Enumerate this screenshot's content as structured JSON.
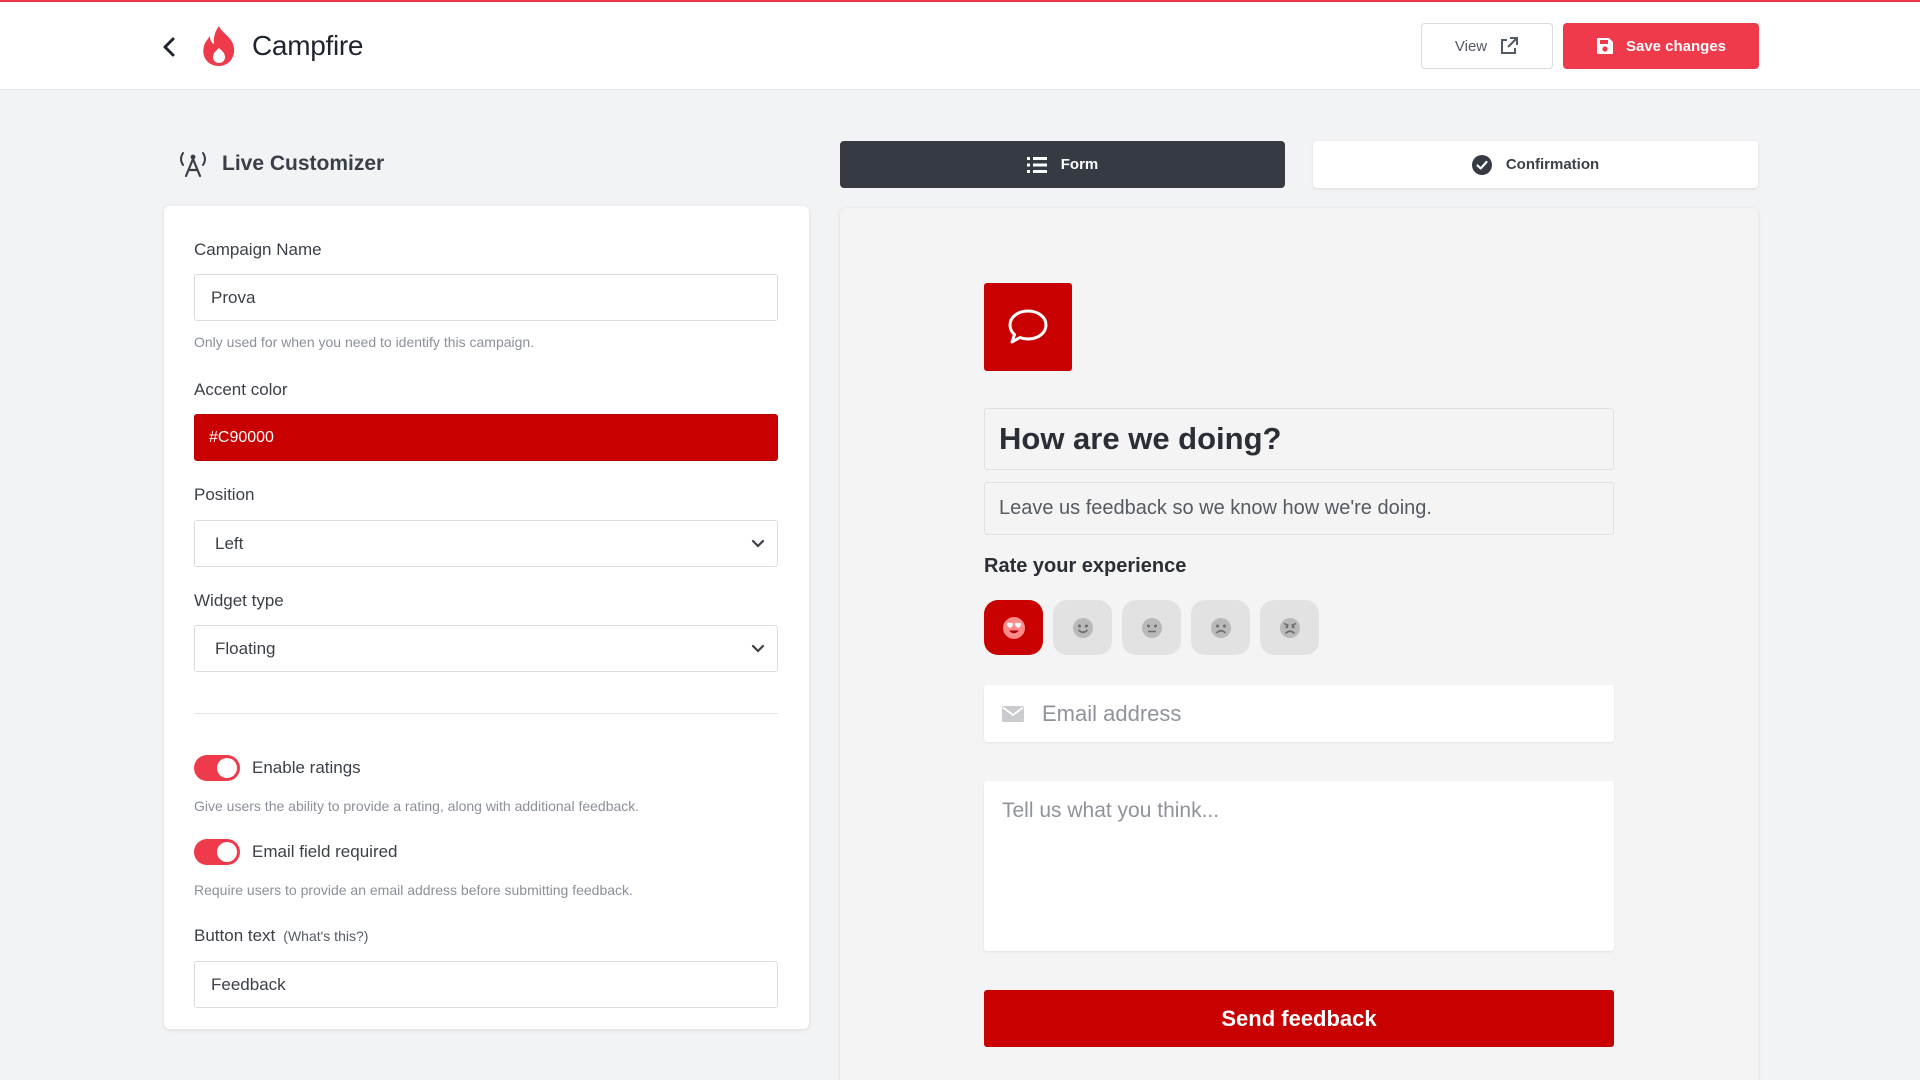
{
  "brand": {
    "name": "Campfire",
    "accent": "#ee3a4b"
  },
  "header": {
    "view_label": "View",
    "save_label": "Save changes"
  },
  "customizer": {
    "title": "Live Customizer",
    "campaign_name": {
      "label": "Campaign Name",
      "value": "Prova",
      "help": "Only used for when you need to identify this campaign."
    },
    "accent_color": {
      "label": "Accent color",
      "value": "#C90000"
    },
    "position": {
      "label": "Position",
      "selected": "Left"
    },
    "widget_type": {
      "label": "Widget type",
      "selected": "Floating"
    },
    "enable_ratings": {
      "label": "Enable ratings",
      "enabled": true,
      "help": "Give users the ability to provide a rating, along with additional feedback."
    },
    "email_required": {
      "label": "Email field required",
      "enabled": true,
      "help": "Require users to provide an email address before submitting feedback."
    },
    "button_text": {
      "label": "Button text",
      "hint": "(What's this?)",
      "value": "Feedback"
    }
  },
  "tabs": [
    {
      "label": "Form",
      "active": true
    },
    {
      "label": "Confirmation",
      "active": false
    }
  ],
  "preview": {
    "accent": "#C90000",
    "title": "How are we doing?",
    "subtitle": "Leave us feedback so we know how we're doing.",
    "rate_label": "Rate your experience",
    "ratings": [
      "love",
      "happy",
      "neutral",
      "sad",
      "angry"
    ],
    "selected_rating": 0,
    "email_placeholder": "Email address",
    "message_placeholder": "Tell us what you think...",
    "send_label": "Send feedback"
  }
}
